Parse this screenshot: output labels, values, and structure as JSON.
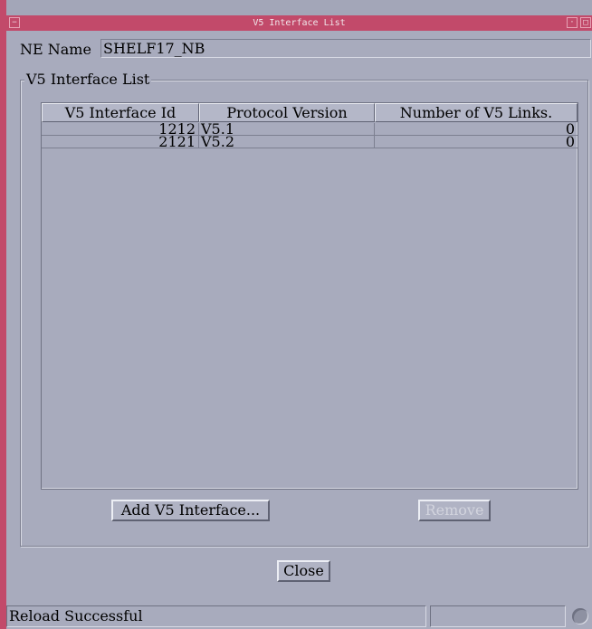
{
  "window": {
    "title": "V5 Interface List",
    "menu_glyph": "−",
    "min_glyph": "·",
    "max_glyph": "□"
  },
  "ne": {
    "label": "NE Name",
    "value": "SHELF17_NB"
  },
  "group": {
    "title": "V5 Interface List"
  },
  "table": {
    "headers": [
      "V5 Interface Id",
      "Protocol Version",
      "Number of V5 Links."
    ],
    "rows": [
      {
        "id": "1212",
        "version": "V5.1",
        "links": "0"
      },
      {
        "id": "2121",
        "version": "V5.2",
        "links": "0"
      }
    ]
  },
  "buttons": {
    "add": "Add V5 Interface...",
    "remove": "Remove",
    "close": "Close"
  },
  "status": {
    "text": "Reload Successful",
    "icon": "status-indicator-icon"
  }
}
